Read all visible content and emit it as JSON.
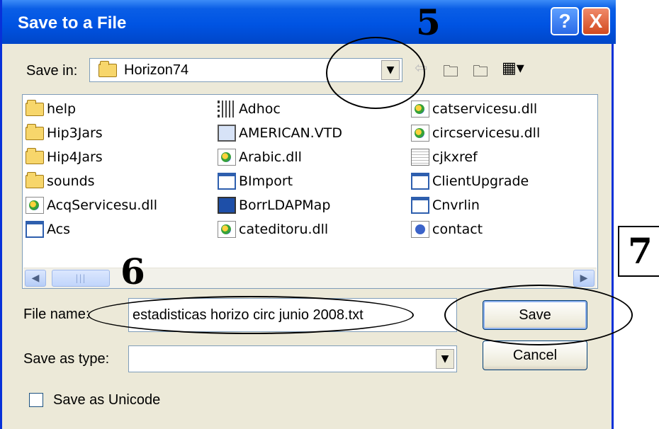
{
  "window": {
    "title": "Save to a File",
    "help_glyph": "?",
    "close_glyph": "X"
  },
  "save_in": {
    "label": "Save in:",
    "value": "Horizon74"
  },
  "toolbar": {
    "icons": [
      "back-arrow-icon",
      "up-folder-icon",
      "new-folder-icon",
      "view-menu-icon"
    ]
  },
  "files": [
    {
      "name": "help",
      "icon": "folder-icon"
    },
    {
      "name": "Hip3Jars",
      "icon": "folder-icon"
    },
    {
      "name": "Hip4Jars",
      "icon": "folder-icon"
    },
    {
      "name": "sounds",
      "icon": "folder-icon"
    },
    {
      "name": "AcqServicesu.dll",
      "icon": "dll-icon"
    },
    {
      "name": "Acs",
      "icon": "window-icon"
    },
    {
      "name": "Adhoc",
      "icon": "adhoc-icon"
    },
    {
      "name": "AMERICAN.VTD",
      "icon": "vtd-icon"
    },
    {
      "name": "Arabic.dll",
      "icon": "dll-icon"
    },
    {
      "name": "BImport",
      "icon": "window-icon"
    },
    {
      "name": "BorrLDAPMap",
      "icon": "map-icon"
    },
    {
      "name": "cateditoru.dll",
      "icon": "dll-icon"
    },
    {
      "name": "catservicesu.dll",
      "icon": "dll-icon"
    },
    {
      "name": "circservicesu.dll",
      "icon": "dll-icon"
    },
    {
      "name": "cjkxref",
      "icon": "document-icon"
    },
    {
      "name": "ClientUpgrade",
      "icon": "window-icon"
    },
    {
      "name": "Cnvrlin",
      "icon": "window-icon"
    },
    {
      "name": "contact",
      "icon": "contact-icon"
    }
  ],
  "file_name": {
    "label": "File name:",
    "value": "estadisticas horizo circ junio 2008.txt"
  },
  "save_as_type": {
    "label": "Save as type:",
    "value": ""
  },
  "buttons": {
    "save": "Save",
    "cancel": "Cancel"
  },
  "unicode_checkbox": {
    "label": "Save as Unicode",
    "checked": false
  },
  "annotations": {
    "n5": "5",
    "n6": "6",
    "n7": "7"
  }
}
